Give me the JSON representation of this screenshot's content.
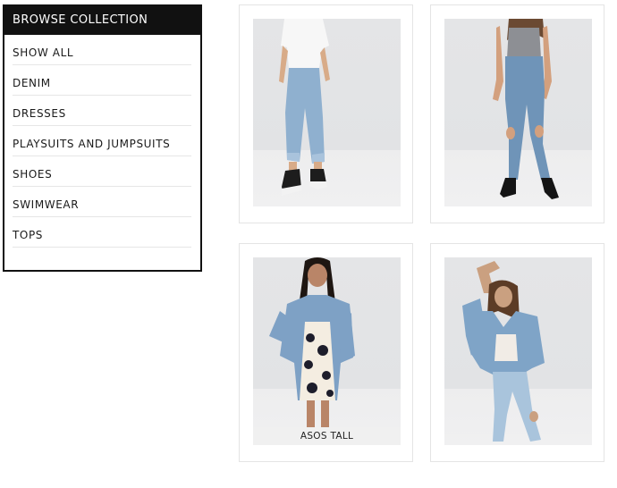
{
  "sidebar": {
    "title": "BROWSE COLLECTION",
    "items": [
      {
        "label": "SHOW ALL"
      },
      {
        "label": "DENIM"
      },
      {
        "label": "DRESSES"
      },
      {
        "label": "PLAYSUITS AND JUMPSUITS"
      },
      {
        "label": "SHOES"
      },
      {
        "label": "SWIMWEAR"
      },
      {
        "label": "TOPS"
      }
    ]
  },
  "products": [
    {
      "image": "model in white t-shirt, light wash cropped jeans and black sneakers",
      "badge": ""
    },
    {
      "image": "model in grey tank top, ripped skinny jeans and black heels",
      "badge": ""
    },
    {
      "image": "model in oversized denim jacket over leopard print dress",
      "badge": "ASOS TALL"
    },
    {
      "image": "model in denim jacket with light ripped jeans",
      "badge": ""
    }
  ]
}
